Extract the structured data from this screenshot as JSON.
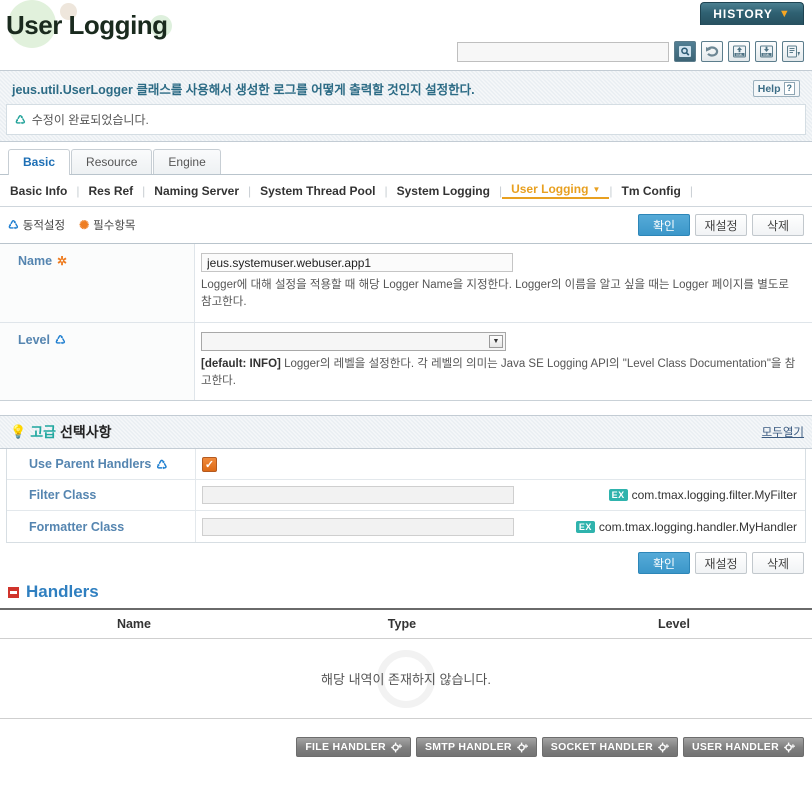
{
  "header": {
    "title": "User Logging",
    "history_label": "HISTORY",
    "history_caret": "chevron-down",
    "search_value": "",
    "search_placeholder": "",
    "tools": [
      {
        "name": "search-icon",
        "label": "Search"
      },
      {
        "name": "refresh-icon",
        "label": "Refresh"
      },
      {
        "name": "xml-upload-icon",
        "label": "XML Upload"
      },
      {
        "name": "xml-download-icon",
        "label": "XML Download"
      },
      {
        "name": "export-icon",
        "label": "Export"
      }
    ]
  },
  "banner": {
    "description": "jeus.util.UserLogger 클래스를 사용해서 생성한 로그를 어떻게 출력할 것인지 설정한다.",
    "help_label": "Help",
    "help_mark": "?",
    "status_icon": "refresh-icon",
    "status_text": "수정이 완료되었습니다."
  },
  "tabs": [
    {
      "label": "Basic",
      "active": true
    },
    {
      "label": "Resource",
      "active": false
    },
    {
      "label": "Engine",
      "active": false
    }
  ],
  "subnav": [
    {
      "label": "Basic Info",
      "current": false
    },
    {
      "label": "Res Ref",
      "current": false
    },
    {
      "label": "Naming Server",
      "current": false
    },
    {
      "label": "System Thread Pool",
      "current": false
    },
    {
      "label": "System Logging",
      "current": false
    },
    {
      "label": "User Logging",
      "current": true
    },
    {
      "label": "Tm Config",
      "current": false
    }
  ],
  "legend": {
    "dynamic_icon": "refresh-icon",
    "dynamic_label": "동적설정",
    "required_icon": "asterisk-icon",
    "required_label": "필수항목"
  },
  "actions": {
    "confirm": "확인",
    "reset": "재설정",
    "delete": "삭제"
  },
  "form": {
    "name": {
      "label": "Name",
      "required_mark": "✲",
      "value": "jeus.systemuser.webuser.app1",
      "description": "Logger에 대해 설정을 적용할 때 해당 Logger Name을 지정한다. Logger의 이름을 알고 싶을 때는 Logger 페이지를 별도로 참고한다."
    },
    "level": {
      "label": "Level",
      "dynamic_mark": "⟳",
      "value": "",
      "default_tag": "[default: INFO]",
      "description": "Logger의 레벨을 설정한다. 각 레벨의 의미는 Java SE Logging API의 \"Level Class Documentation\"을 참고한다."
    }
  },
  "advanced": {
    "bulb_icon": "lightbulb-icon",
    "title_keyword": "고급",
    "title_rest": "선택사항",
    "expand_all": "모두열기",
    "use_parent_handlers": {
      "label": "Use Parent Handlers",
      "dynamic_mark": "⟳",
      "checked": true,
      "check_glyph": "✓"
    },
    "filter_class": {
      "label": "Filter Class",
      "value": "",
      "ex_badge": "EX",
      "example": "com.tmax.logging.filter.MyFilter"
    },
    "formatter_class": {
      "label": "Formatter Class",
      "value": "",
      "ex_badge": "EX",
      "example": "com.tmax.logging.handler.MyHandler"
    }
  },
  "handlers": {
    "section_title": "Handlers",
    "columns": [
      "Name",
      "Type",
      "Level"
    ],
    "empty_message": "해당 내역이 존재하지 않습니다.",
    "buttons": [
      {
        "label": "FILE HANDLER",
        "icon": "gear-plus-icon"
      },
      {
        "label": "SMTP HANDLER",
        "icon": "gear-plus-icon"
      },
      {
        "label": "SOCKET HANDLER",
        "icon": "gear-plus-icon"
      },
      {
        "label": "USER HANDLER",
        "icon": "gear-plus-icon"
      }
    ]
  },
  "colors": {
    "accent_blue": "#5585b0",
    "link_orange": "#e8a020",
    "primary_button": "#3b97c9",
    "teal": "#2fb3ad",
    "required_orange": "#ee7d22"
  }
}
